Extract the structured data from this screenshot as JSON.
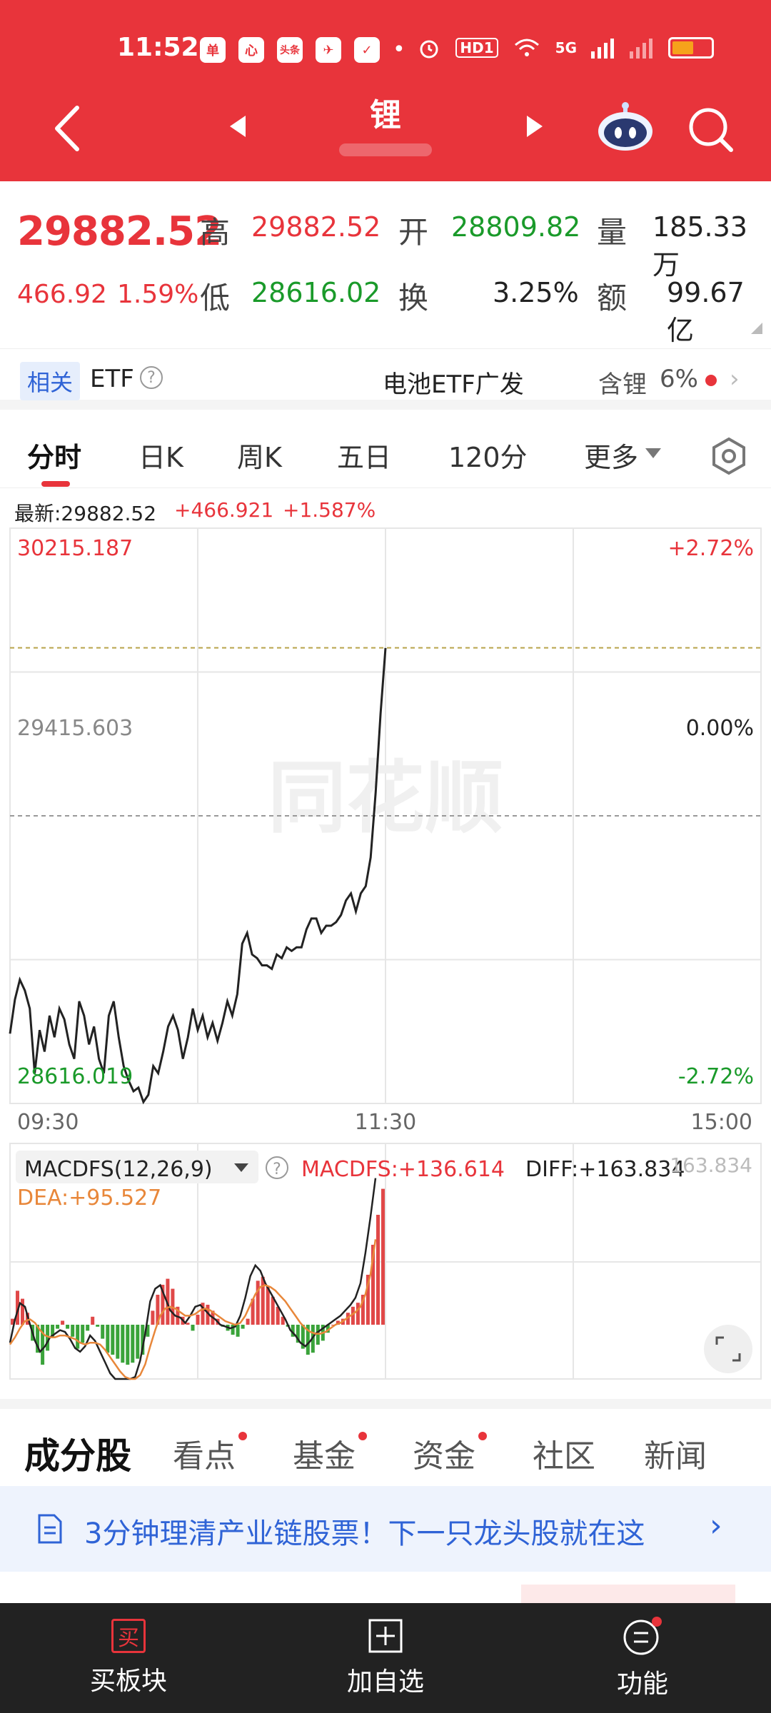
{
  "status": {
    "time": "11:52",
    "apps": [
      "单",
      "心",
      "头条",
      "✈",
      "✓"
    ],
    "hd_badge": "HD1",
    "signal_label": "5G"
  },
  "nav": {
    "title": "锂"
  },
  "quote": {
    "price": "29882.52",
    "change": "466.92",
    "change_pct": "1.59%",
    "labels": {
      "high": "高",
      "open": "开",
      "volume": "量",
      "low": "低",
      "turnover": "换",
      "amount": "额"
    },
    "high": "29882.52",
    "open": "28809.82",
    "volume": "185.33万",
    "low": "28616.02",
    "turnover_rate": "3.25%",
    "amount": "99.67亿"
  },
  "etf": {
    "tag": "相关",
    "label": "ETF",
    "help": "?",
    "name": "电池ETF广发",
    "contains_label": "含锂",
    "contains_pct": "6%",
    "arrow": "›"
  },
  "tabs": [
    "分时",
    "日K",
    "周K",
    "五日",
    "120分",
    "更多"
  ],
  "info": {
    "latest": "最新:29882.52",
    "change": "+466.921",
    "pct": "+1.587%"
  },
  "chart_data": [
    {
      "type": "line",
      "x_ticks": [
        "09:30",
        "11:30",
        "15:00"
      ],
      "y_top_label": "30215.187",
      "y_mid_label": "29415.603",
      "y_bottom_label": "28616.019",
      "right_top_label": "+2.72%",
      "right_mid_label": "0.00%",
      "right_bottom_label": "-2.72%",
      "ylim": [
        28616.019,
        30215.187
      ],
      "prev_close": 29415.603,
      "reference_level": 29882.52,
      "series": [
        {
          "values": [
            28810,
            28905,
            28960,
            28930,
            28880,
            28700,
            28820,
            28760,
            28860,
            28800,
            28880,
            28850,
            28780,
            28740,
            28900,
            28860,
            28780,
            28830,
            28740,
            28700,
            28860,
            28900,
            28800,
            28720,
            28680,
            28650,
            28660,
            28620,
            28640,
            28720,
            28700,
            28760,
            28830,
            28860,
            28820,
            28740,
            28800,
            28880,
            28820,
            28860,
            28800,
            28840,
            28790,
            28840,
            28900,
            28860,
            28920,
            29060,
            29090,
            29030,
            29020,
            29000,
            29000,
            28990,
            29030,
            29020,
            29050,
            29040,
            29050,
            29050,
            29100,
            29130,
            29130,
            29090,
            29110,
            29110,
            29120,
            29140,
            29180,
            29200,
            29150,
            29200,
            29220,
            29300,
            29480,
            29700,
            29882
          ]
        }
      ]
    },
    {
      "type": "bar",
      "indicator": "MACDFS(12,26,9)",
      "macd_label": "MACDFS:+136.614",
      "diff_label": "DIFF:+163.834",
      "dea_label": "DEA:+95.527",
      "top_label": "163.834",
      "help": "?",
      "values": [
        6,
        34,
        26,
        12,
        -16,
        -28,
        -40,
        -26,
        -12,
        -4,
        4,
        -4,
        -12,
        -24,
        -18,
        -6,
        8,
        -2,
        -14,
        -28,
        -30,
        -34,
        -38,
        -40,
        -38,
        -34,
        -30,
        -12,
        14,
        30,
        40,
        46,
        36,
        18,
        8,
        2,
        -6,
        10,
        22,
        20,
        14,
        6,
        -2,
        -6,
        -10,
        -12,
        -4,
        6,
        26,
        44,
        48,
        38,
        28,
        18,
        8,
        -2,
        -12,
        -18,
        -24,
        -30,
        -28,
        -20,
        -16,
        -8,
        0,
        4,
        6,
        12,
        18,
        22,
        30,
        50,
        80,
        110,
        136
      ],
      "diff": [
        -20,
        6,
        24,
        20,
        0,
        -18,
        -30,
        -24,
        -14,
        -10,
        -6,
        -8,
        -16,
        -26,
        -30,
        -24,
        -12,
        -18,
        -30,
        -42,
        -54,
        -62,
        -70,
        -76,
        -70,
        -58,
        -40,
        -10,
        26,
        40,
        44,
        30,
        16,
        10,
        8,
        2,
        10,
        20,
        22,
        16,
        10,
        6,
        0,
        -2,
        -4,
        -2,
        10,
        30,
        54,
        66,
        60,
        46,
        36,
        26,
        16,
        6,
        -6,
        -12,
        -20,
        -24,
        -18,
        -10,
        -6,
        -2,
        2,
        6,
        10,
        16,
        22,
        30,
        46,
        80,
        120,
        163
      ],
      "dea": [
        -22,
        -14,
        -4,
        4,
        6,
        2,
        -6,
        -12,
        -14,
        -14,
        -12,
        -12,
        -14,
        -16,
        -20,
        -22,
        -20,
        -20,
        -22,
        -28,
        -36,
        -44,
        -52,
        -58,
        -62,
        -62,
        -56,
        -44,
        -24,
        -6,
        10,
        18,
        20,
        18,
        14,
        10,
        10,
        12,
        16,
        18,
        16,
        12,
        8,
        4,
        2,
        0,
        2,
        10,
        22,
        34,
        42,
        44,
        42,
        38,
        32,
        26,
        18,
        10,
        2,
        -4,
        -8,
        -10,
        -10,
        -8,
        -4,
        0,
        2,
        6,
        10,
        14,
        20,
        34,
        56,
        95
      ]
    }
  ],
  "content_tabs": [
    "成分股",
    "看点",
    "基金",
    "资金",
    "社区",
    "新闻"
  ],
  "banner": {
    "text": "3分钟理清产业链股票！下一只龙头股就在这",
    "arrow": "›"
  },
  "actionbar": {
    "buy_icon": "买",
    "buy_label": "买板块",
    "add_label": "加自选",
    "func_label": "功能"
  }
}
